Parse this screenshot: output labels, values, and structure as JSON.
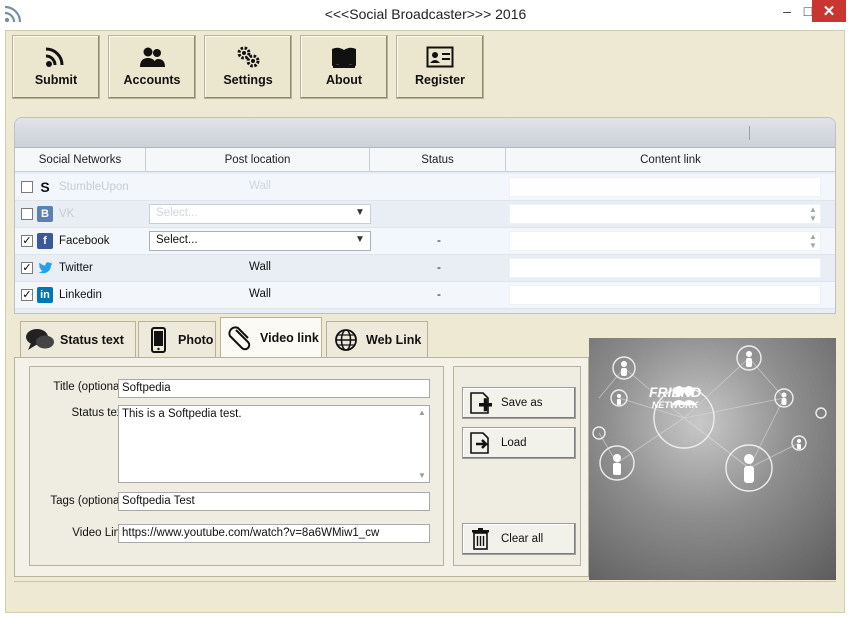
{
  "window": {
    "title": "<<<Social Broadcaster>>> 2016",
    "icon": "rss-icon",
    "controls": {
      "minimize": "–",
      "maximize": "□",
      "close": "✕"
    }
  },
  "toolbar": [
    {
      "label": "Submit",
      "icon": "rss-icon"
    },
    {
      "label": "Accounts",
      "icon": "users-icon"
    },
    {
      "label": "Settings",
      "icon": "gears-icon"
    },
    {
      "label": "About",
      "icon": "book-icon"
    },
    {
      "label": "Register",
      "icon": "id-card-icon"
    }
  ],
  "grid": {
    "headers": [
      "Social Networks",
      "Post location",
      "Status",
      "Content link"
    ],
    "rows": [
      {
        "checked": false,
        "icon": "stumbleupon-icon",
        "icon_color": "#ffffff",
        "name": "StumbleUpon",
        "post": "Wall",
        "post_type": "text",
        "status": "",
        "enabled": false
      },
      {
        "checked": false,
        "icon": "vk-icon",
        "icon_color": "#5b80b1",
        "name": "VK",
        "post": "Select...",
        "post_type": "select",
        "status": "",
        "enabled": false
      },
      {
        "checked": true,
        "icon": "facebook-icon",
        "icon_color": "#3b5998",
        "name": "Facebook",
        "post": "Select...",
        "post_type": "select",
        "status": "-",
        "enabled": true
      },
      {
        "checked": true,
        "icon": "twitter-icon",
        "icon_color": "#1da1f2",
        "name": "Twitter",
        "post": "Wall",
        "post_type": "text",
        "status": "-",
        "enabled": true
      },
      {
        "checked": true,
        "icon": "linkedin-icon",
        "icon_color": "#0077b5",
        "name": "Linkedin",
        "post": "Wall",
        "post_type": "text",
        "status": "-",
        "enabled": true
      }
    ]
  },
  "tabs": [
    {
      "label": "Status text",
      "icon": "speech-bubbles-icon",
      "active": false
    },
    {
      "label": "Photo",
      "icon": "phone-icon",
      "active": false
    },
    {
      "label": "Video link",
      "icon": "paperclip-icon",
      "active": true
    },
    {
      "label": "Web Link",
      "icon": "globe-icon",
      "active": false
    }
  ],
  "form": {
    "title_label": "Title (optional):",
    "title_value": "Softpedia",
    "status_label": "Status text:",
    "status_value": "This is a Softpedia test.",
    "tags_label": "Tags (optional):",
    "tags_value": "Softpedia Test",
    "video_label": "Video Link:",
    "video_value": "https://www.youtube.com/watch?v=8a6WMiw1_cw"
  },
  "side_buttons": {
    "save_as": "Save as",
    "load": "Load",
    "clear_all": "Clear all"
  },
  "image": {
    "line1": "FRIEND",
    "line2": "NETWORK"
  }
}
